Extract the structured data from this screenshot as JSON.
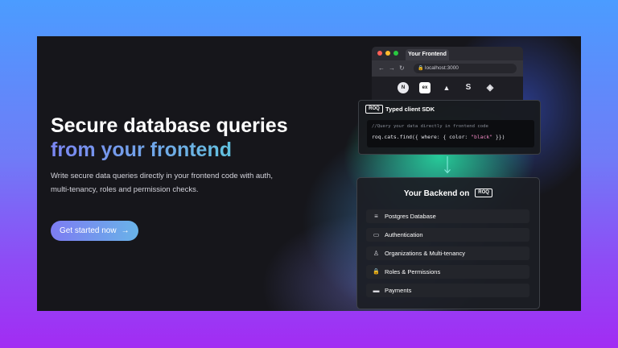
{
  "hero": {
    "title_line1": "Secure database queries",
    "title_line2": "from your frontend",
    "subtitle": "Write secure data queries directly in your frontend code with auth, multi-tenancy, roles and permission checks.",
    "cta_label": "Get started now",
    "cta_arrow": "→"
  },
  "browser": {
    "tab_label": "Your Frontend",
    "url": "localhost:3000",
    "nav_icons": [
      "back-arrow-icon",
      "forward-arrow-icon",
      "reload-icon"
    ],
    "frameworks": [
      {
        "name": "nextjs-icon",
        "glyph": "N"
      },
      {
        "name": "express-icon",
        "glyph": "ex"
      },
      {
        "name": "nuxt-icon",
        "glyph": "▲"
      },
      {
        "name": "svelte-icon",
        "glyph": "S"
      },
      {
        "name": "remix-icon",
        "glyph": "◈"
      }
    ]
  },
  "sdk": {
    "logo_text": "ROQ",
    "title": "Typed client SDK",
    "code_comment": "//Query your data directly in frontend code",
    "code_prefix": "roq.cats.find({ where: { color: ",
    "code_string": "\"black\"",
    "code_suffix": " }})"
  },
  "backend": {
    "title": "Your Backend on",
    "logo_text": "ROQ",
    "features": [
      {
        "label": "Postgres Database",
        "icon": "database-icon",
        "glyph": "≡"
      },
      {
        "label": "Authentication",
        "icon": "id-card-icon",
        "glyph": "▭"
      },
      {
        "label": "Organizations & Multi-tenancy",
        "icon": "users-icon",
        "glyph": "♙"
      },
      {
        "label": "Roles & Permissions",
        "icon": "lock-icon",
        "glyph": "🔒"
      },
      {
        "label": "Payments",
        "icon": "credit-card-icon",
        "glyph": "▬"
      }
    ]
  },
  "colors": {
    "outer_top": "#4b9cff",
    "outer_bottom": "#a22cf3",
    "frame_bg": "#16161b",
    "glow": "#28e6aa",
    "title_gradient_start": "#7b86f2",
    "title_gradient_end": "#4fd8d8"
  }
}
